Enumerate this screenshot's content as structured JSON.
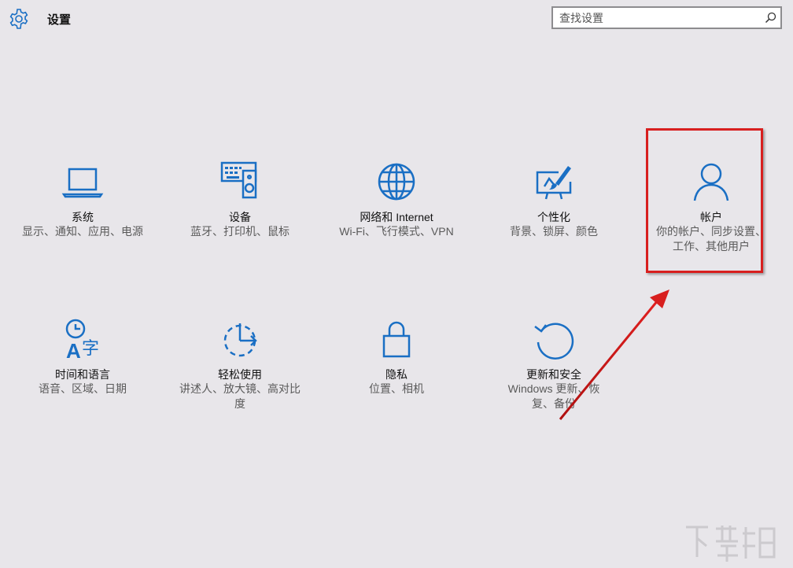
{
  "header": {
    "title": "设置",
    "search_placeholder": "查找设置"
  },
  "tiles": [
    {
      "label": "系统",
      "desc": "显示、通知、应用、电源",
      "icon": "laptop-icon"
    },
    {
      "label": "设备",
      "desc": "蓝牙、打印机、鼠标",
      "icon": "devices-icon"
    },
    {
      "label": "网络和 Internet",
      "desc": "Wi-Fi、飞行模式、VPN",
      "icon": "globe-icon"
    },
    {
      "label": "个性化",
      "desc": "背景、锁屏、颜色",
      "icon": "personalization-icon"
    },
    {
      "label": "帐户",
      "desc": "你的帐户、同步设置、工作、其他用户",
      "icon": "person-icon"
    },
    {
      "label": "时间和语言",
      "desc": "语音、区域、日期",
      "icon": "time-language-icon"
    },
    {
      "label": "轻松使用",
      "desc": "讲述人、放大镜、高对比度",
      "icon": "ease-of-access-icon"
    },
    {
      "label": "隐私",
      "desc": "位置、相机",
      "icon": "lock-icon"
    },
    {
      "label": "更新和安全",
      "desc": "Windows 更新、恢复、备份",
      "icon": "update-icon"
    }
  ],
  "colors": {
    "accent": "#1a6fc4",
    "background": "#e8e6ea",
    "annotation_red": "#d81f1f"
  }
}
